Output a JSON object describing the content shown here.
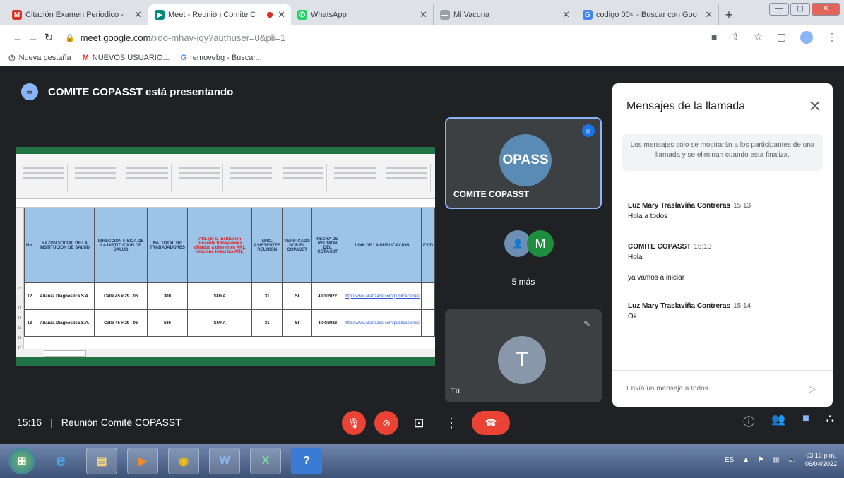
{
  "browser": {
    "tabs": [
      {
        "title": "Citación Examen Periodico - ",
        "fav": "M",
        "fav_color": "#d93025"
      },
      {
        "title": "Meet - Reunión Comite C",
        "fav": "▶",
        "fav_color": "#00897b"
      },
      {
        "title": "WhatsApp",
        "fav": "✆",
        "fav_color": "#25d366"
      },
      {
        "title": "Mi Vacuna",
        "fav": "—",
        "fav_color": "#9aa0a6"
      },
      {
        "title": "codigo 00< - Buscar con Goo",
        "fav": "G",
        "fav_color": "#4285f4"
      }
    ],
    "url_host": "meet.google.com",
    "url_rest": "/xdo-mhav-iqy?authuser=0&pli=1",
    "bookmarks": [
      {
        "label": "Nueva pestaña",
        "icon": "globe-icon",
        "glyph": "◎"
      },
      {
        "label": "NUEVOS USUARIO...",
        "icon": "gmail-icon",
        "glyph": "M"
      },
      {
        "label": "removebg - Buscar...",
        "icon": "google-icon",
        "glyph": "G"
      }
    ]
  },
  "meet": {
    "presenting_banner": "COMITE COPASST está presentando",
    "presenter_initials": "OPASS",
    "presenter_name": "COMITE COPASST",
    "more_label": "5 más",
    "more_initial": "M",
    "self_initial": "T",
    "self_label": "Tú",
    "time": "15:16",
    "meeting_title": "Reunión Comité COPASST"
  },
  "sheet": {
    "headers": [
      {
        "text": "No.",
        "red": false
      },
      {
        "text": "RAZON SOCIAL DE LA INSTITUCION DE SALUD",
        "red": false
      },
      {
        "text": "DIRECCION FISICA DE LA INSTITUCION DE SALUD",
        "red": false
      },
      {
        "text": "No. TOTAL DE TRABAJADORES",
        "red": false
      },
      {
        "text": "ARL (Si la institución presenta trabajadores afiliados a diferentes ARL, relacione todas las ARL)",
        "red": true
      },
      {
        "text": "NRO. ASISTENTES REUNION",
        "red": false
      },
      {
        "text": "VERIFICADO POR EL COPASST",
        "red": false
      },
      {
        "text": "FECHA DE REUNION DEL COPASST",
        "red": false
      },
      {
        "text": "LINK DE LA PUBLICACION",
        "red": false
      },
      {
        "text": "EVID",
        "red": false
      }
    ],
    "rows": [
      [
        "12",
        "Alianza Diagnostica S.A.",
        "Calle 45 # 29 - 06",
        "300",
        "SURA",
        "31",
        "SI",
        "4/03/2022",
        "http://www.alianzadx.com/publicaciones",
        ""
      ],
      [
        "13",
        "Alianza Diagnostica S.A.",
        "Calle 45 # 29 - 06",
        "586",
        "SURA",
        "31",
        "SI",
        "4/04/2022",
        "http://www.alianzadx.com/publicaciones",
        ""
      ]
    ],
    "row_numbers": [
      "",
      "",
      "",
      "",
      "",
      "",
      "",
      "",
      "12",
      "",
      "13",
      "14",
      "15",
      "16",
      "17"
    ]
  },
  "chat": {
    "title": "Mensajes de la llamada",
    "note": "Los mensajes solo se mostrarán a los participantes de una llamada y se eliminan cuando esta finaliza.",
    "messages": [
      {
        "sender": "Luz Mary Traslaviña Contreras",
        "time": "15:13",
        "text": "Hola a todos"
      },
      {
        "sender": "COMITE COPASST",
        "time": "15:13",
        "text": "Hola"
      },
      {
        "sender": "",
        "time": "",
        "text": "ya vamos a iniciar"
      },
      {
        "sender": "Luz Mary Traslaviña Contreras",
        "time": "15:14",
        "text": "Ok"
      }
    ],
    "placeholder": "Envía un mensaje a todos"
  },
  "taskbar": {
    "clock_time": "03:16 p.m.",
    "clock_date": "06/04/2022",
    "tray_lang": "ES"
  },
  "colors": {
    "meet_bg": "#202124",
    "accent_blue": "#8ab4f8",
    "red": "#ea4335",
    "excel_green": "#217346",
    "header_blue": "#9dc3e6"
  }
}
